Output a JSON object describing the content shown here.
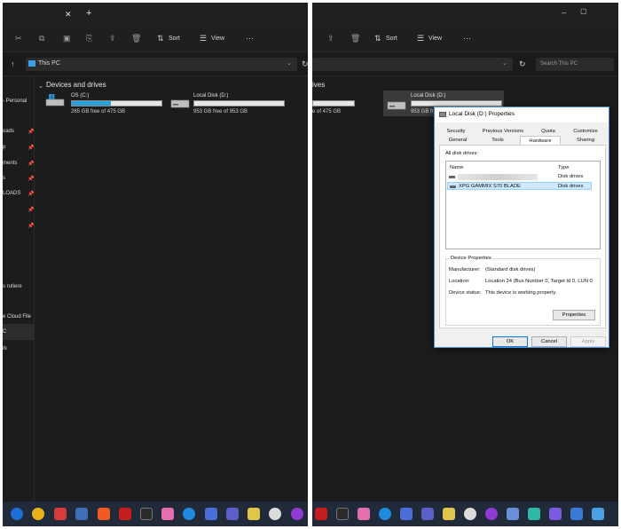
{
  "left": {
    "toolbar": {
      "sort": "Sort",
      "view": "View",
      "more": "···"
    },
    "address": {
      "path": "This PC"
    },
    "nav": {
      "items": [
        "- Personal",
        "oads",
        "p",
        "ments",
        "s",
        "LOADS",
        "s rutiere",
        "e Cloud File",
        "C",
        "rk"
      ]
    },
    "section_title": "Devices and drives",
    "drives": [
      {
        "name": "OS (C:)",
        "free": "265 GB free of 475 GB",
        "used_fraction": 0.44
      },
      {
        "name": "Local Disk (D:)",
        "free": "953 GB free of 953 GB",
        "used_fraction": 0.0
      }
    ]
  },
  "right": {
    "toolbar": {
      "sort": "Sort",
      "view": "View",
      "more": "···"
    },
    "address": {
      "search_placeholder": "Search This PC"
    },
    "section_title_partial": "ives",
    "drive_partial_free_c": "e of 475 GB",
    "drive_d": {
      "name": "Local Disk (D:)",
      "free": "953 GB fre"
    }
  },
  "dialog": {
    "title": "Local Disk (D:) Properties",
    "tabs_row1": [
      "Security",
      "Previous Versions",
      "Quota",
      "Customize"
    ],
    "tabs_row2": [
      "General",
      "Tools",
      "Hardware",
      "Sharing"
    ],
    "active_tab": "Hardware",
    "all_disk_drives_label": "All disk drives:",
    "columns": {
      "name": "Name",
      "type": "Type"
    },
    "rows": [
      {
        "name": "",
        "type": "Disk drives"
      },
      {
        "name": "XPG GAMMIX S70 BLADE",
        "type": "Disk drives"
      }
    ],
    "device_properties": {
      "title": "Device Properties",
      "manufacturer_label": "Manufacturer:",
      "manufacturer_value": "(Standard disk drives)",
      "location_label": "Location:",
      "location_value": "Location 24 (Bus Number 0, Target Id 0, LUN 0",
      "status_label": "Device status:",
      "status_value": "This device is working properly.",
      "properties_button": "Properties"
    },
    "buttons": {
      "ok": "OK",
      "cancel": "Cancel",
      "apply": "Apply"
    }
  }
}
